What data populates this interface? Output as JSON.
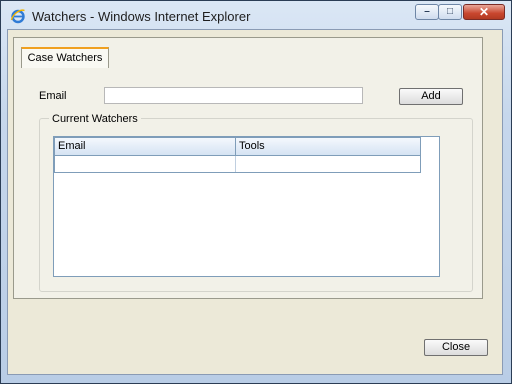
{
  "window": {
    "title": "Watchers - Windows Internet Explorer",
    "controls": {
      "minimize": "–",
      "maximize": "□",
      "close": "✕"
    }
  },
  "tab": {
    "label": "Case Watchers"
  },
  "form": {
    "email_label": "Email",
    "email_value": "",
    "email_placeholder": "",
    "add_label": "Add"
  },
  "watchers": {
    "legend": "Current Watchers",
    "columns": [
      "Email",
      "Tools"
    ],
    "rows": []
  },
  "footer": {
    "close_label": "Close"
  },
  "colors": {
    "tab_accent": "#f0a020",
    "grid_border": "#7f9db9",
    "header_top": "#f4f8fd",
    "header_bottom": "#d5e3f3"
  },
  "icons": [
    "internet-explorer-icon",
    "minimize-icon",
    "maximize-icon",
    "close-icon"
  ]
}
